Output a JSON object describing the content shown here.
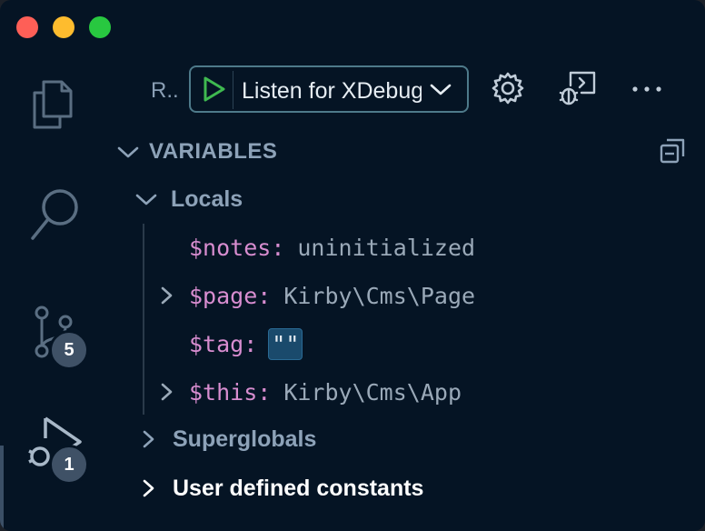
{
  "toolbar": {
    "run_label": "R..",
    "config_name": "Listen for XDebug"
  },
  "activity": {
    "items": [
      {
        "name": "explorer",
        "icon": "files-icon"
      },
      {
        "name": "search",
        "icon": "search-icon"
      },
      {
        "name": "source-control",
        "icon": "source-control-icon",
        "badge": "5"
      },
      {
        "name": "run-debug",
        "icon": "debug-icon",
        "badge": "1"
      }
    ]
  },
  "variables": {
    "title": "VARIABLES",
    "scopes": [
      {
        "label": "Locals",
        "expanded": true,
        "vars": [
          {
            "name": "$notes",
            "value": "uninitialized",
            "expandable": false
          },
          {
            "name": "$page",
            "value": "Kirby\\Cms\\Page",
            "expandable": true
          },
          {
            "name": "$tag",
            "value": "\"\"",
            "expandable": false
          },
          {
            "name": "$this",
            "value": "Kirby\\Cms\\App",
            "expandable": true
          }
        ]
      },
      {
        "label": "Superglobals",
        "expanded": false
      },
      {
        "label": "User defined constants",
        "expanded": false
      }
    ]
  },
  "colors": {
    "background": "#051424",
    "var_name": "#d88dd0",
    "play": "#3fb950",
    "badge": "#3f5166"
  }
}
